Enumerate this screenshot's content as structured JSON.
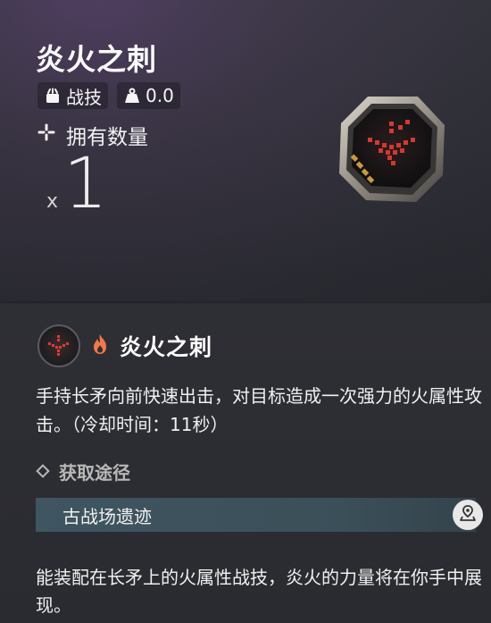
{
  "item": {
    "title": "炎火之刺",
    "type_label": "战技",
    "weight_value": "0.0",
    "own_label": "拥有数量",
    "count_prefix": "x",
    "count": "1"
  },
  "skill": {
    "name": "炎火之刺",
    "description": "手持长矛向前快速出击，对目标造成一次强力的火属性攻击。（冷却时间：11秒）"
  },
  "source": {
    "heading": "获取途径",
    "location": "古战场遗迹"
  },
  "flavor_text": "能装配在长矛上的火属性战技，炎火的力量将在你手中展现。",
  "icons": {
    "type": "bag-icon",
    "weight": "weight-icon",
    "own": "crosshair-icon",
    "element": "fire-icon",
    "source": "diamond-icon",
    "map": "map-pin-icon"
  },
  "colors": {
    "accent_red": "#e03a34",
    "fire_orange": "#f07a4a",
    "source_bar": "#3f5560"
  }
}
